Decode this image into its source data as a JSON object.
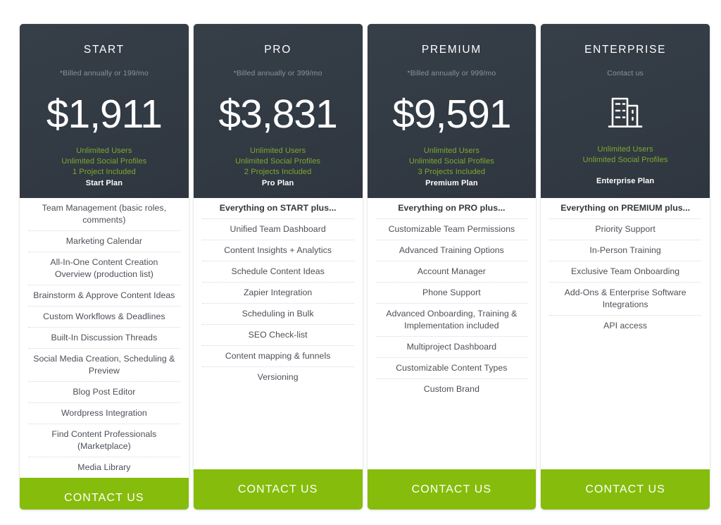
{
  "theme": {
    "page_background": "#ffffff",
    "card_header_background": "#343c46",
    "accent_green": "#86bc0c",
    "perk_green": "#7cab2e",
    "feature_text": "#4c4f57",
    "muted_text": "#8b929b"
  },
  "plans": [
    {
      "name": "START",
      "billing_note": "*Billed annually or 199/mo",
      "price": "$1,911",
      "perks": [
        "Unlimited Users",
        "Unlimited Social Profiles",
        "1 Project Included"
      ],
      "tagline": "Start Plan",
      "features": [
        "Team Management (basic roles, comments)",
        "Marketing Calendar",
        "All-In-One Content Creation Overview (production list)",
        "Brainstorm & Approve Content Ideas",
        "Custom Workflows & Deadlines",
        "Built-In Discussion Threads",
        "Social Media Creation, Scheduling & Preview",
        "Blog Post Editor",
        "Wordpress Integration",
        "Find Content Professionals (Marketplace)",
        "Media Library"
      ],
      "cta_label": "CONTACT US"
    },
    {
      "name": "PRO",
      "billing_note": "*Billed annually or 399/mo",
      "price": "$3,831",
      "perks": [
        "Unlimited Users",
        "Unlimited Social Profiles",
        "2 Projects Included"
      ],
      "tagline": "Pro Plan",
      "features": [
        "Everything on START plus...",
        "Unified Team Dashboard",
        "Content Insights + Analytics",
        "Schedule Content Ideas",
        "Zapier Integration",
        "Scheduling in Bulk",
        "SEO Check-list",
        "Content mapping & funnels",
        "Versioning"
      ],
      "cta_label": "CONTACT US"
    },
    {
      "name": "PREMIUM",
      "billing_note": "*Billed annually or 999/mo",
      "price": "$9,591",
      "perks": [
        "Unlimited Users",
        "Unlimited Social Profiles",
        "3 Projects Included"
      ],
      "tagline": "Premium Plan",
      "features": [
        "Everything on PRO plus...",
        "Customizable Team Permissions",
        "Advanced Training Options",
        "Account Manager",
        "Phone Support",
        "Advanced Onboarding, Training & Implementation included",
        "Multiproject Dashboard",
        "Customizable Content Types",
        "Custom Brand"
      ],
      "cta_label": "CONTACT US"
    },
    {
      "name": "ENTERPRISE",
      "billing_note": "Contact us",
      "price": null,
      "price_icon": "office-building-icon",
      "perks": [
        "Unlimited Users",
        "Unlimited Social Profiles"
      ],
      "tagline": "Enterprise Plan",
      "features": [
        "Everything on PREMIUM plus...",
        "Priority Support",
        "In-Person Training",
        "Exclusive Team Onboarding",
        "Add-Ons & Enterprise Software Integrations",
        "API access"
      ],
      "cta_label": "CONTACT US"
    }
  ]
}
